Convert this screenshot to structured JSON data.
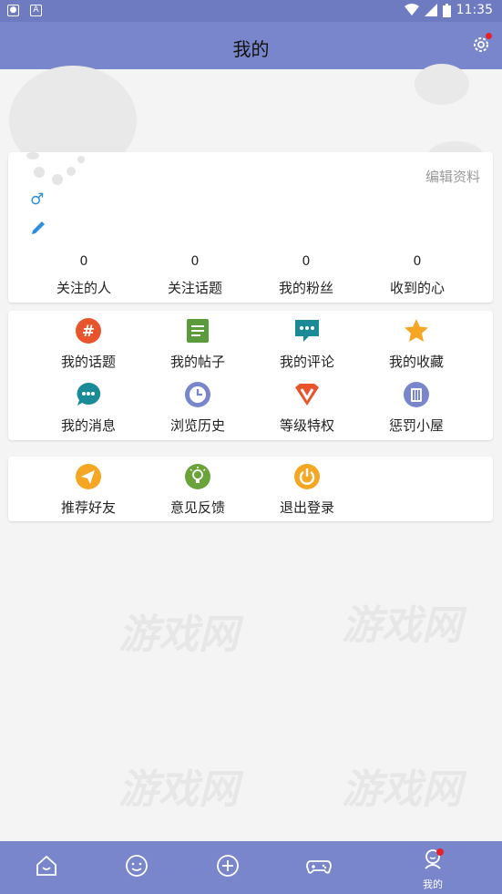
{
  "status_bar": {
    "time": "11:35"
  },
  "header": {
    "title": "我的"
  },
  "profile": {
    "edit_label": "编辑资料",
    "gender_symbol": "♂",
    "stats": [
      {
        "value": "0",
        "label": "关注的人"
      },
      {
        "value": "0",
        "label": "关注话题"
      },
      {
        "value": "0",
        "label": "我的粉丝"
      },
      {
        "value": "0",
        "label": "收到的心"
      }
    ]
  },
  "menu": {
    "row1": [
      {
        "label": "我的话题",
        "icon": "hashtag-icon",
        "color": "#e8542b"
      },
      {
        "label": "我的帖子",
        "icon": "document-icon",
        "color": "#5b9b3c"
      },
      {
        "label": "我的评论",
        "icon": "comment-icon",
        "color": "#1a8a96"
      },
      {
        "label": "我的收藏",
        "icon": "star-icon",
        "color": "#f5a623"
      }
    ],
    "row2": [
      {
        "label": "我的消息",
        "icon": "message-icon",
        "color": "#1a8a96"
      },
      {
        "label": "浏览历史",
        "icon": "clock-icon",
        "color": "#7a86cb"
      },
      {
        "label": "等级特权",
        "icon": "vip-icon",
        "color": "#e8542b"
      },
      {
        "label": "惩罚小屋",
        "icon": "house-icon",
        "color": "#7a86cb"
      }
    ]
  },
  "extra": [
    {
      "label": "推荐好友",
      "icon": "share-icon",
      "color": "#f5a623"
    },
    {
      "label": "意见反馈",
      "icon": "lightbulb-icon",
      "color": "#6aa33a"
    },
    {
      "label": "退出登录",
      "icon": "power-icon",
      "color": "#f5a623"
    }
  ],
  "bottom_nav": {
    "me_label": "我的"
  },
  "watermark": "游戏网"
}
